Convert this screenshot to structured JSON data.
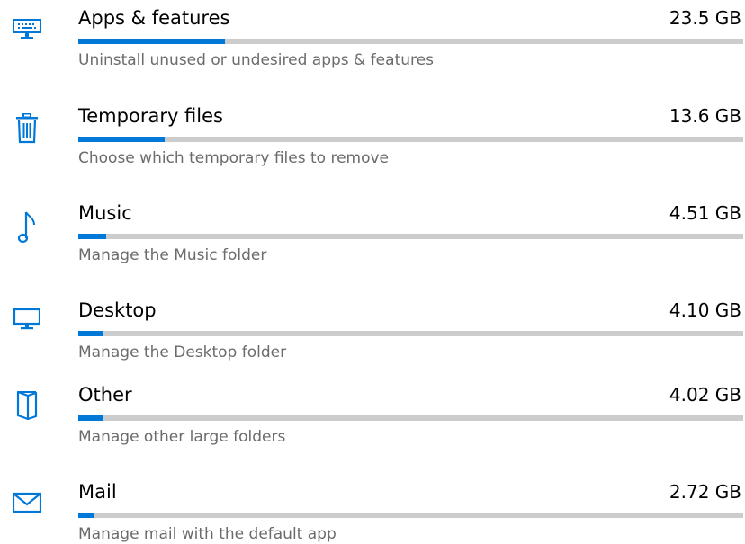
{
  "accent": "#0078d7",
  "track_color": "#cccccc",
  "items": [
    {
      "icon": "apps-keyboard-icon",
      "title": "Apps & features",
      "size": "23.5 GB",
      "usage_fraction": 0.22,
      "description": "Uninstall unused or undesired apps & features"
    },
    {
      "icon": "trash-icon",
      "title": "Temporary files",
      "size": "13.6 GB",
      "usage_fraction": 0.13,
      "description": "Choose which temporary files to remove"
    },
    {
      "icon": "music-note-icon",
      "title": "Music",
      "size": "4.51 GB",
      "usage_fraction": 0.042,
      "description": "Manage the Music folder"
    },
    {
      "icon": "desktop-monitor-icon",
      "title": "Desktop",
      "size": "4.10 GB",
      "usage_fraction": 0.038,
      "description": "Manage the Desktop folder"
    },
    {
      "icon": "folder-icon",
      "title": "Other",
      "size": "4.02 GB",
      "usage_fraction": 0.037,
      "description": "Manage other large folders"
    },
    {
      "icon": "mail-icon",
      "title": "Mail",
      "size": "2.72 GB",
      "usage_fraction": 0.025,
      "description": "Manage mail with the default app"
    }
  ]
}
